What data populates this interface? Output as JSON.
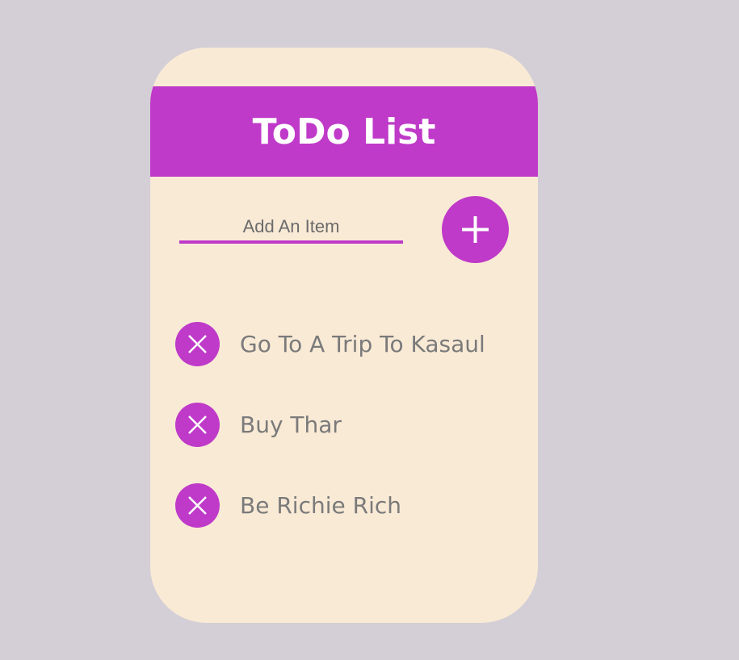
{
  "header": {
    "title": "ToDo List"
  },
  "input": {
    "placeholder": "Add An Item",
    "value": ""
  },
  "add_button": {
    "icon": "plus-icon"
  },
  "items": [
    {
      "text": "Go To A Trip To Kasaul"
    },
    {
      "text": "Buy Thar"
    },
    {
      "text": "Be Richie Rich"
    }
  ],
  "colors": {
    "background": "#d4cfd6",
    "card": "#f9ead6",
    "accent": "#bf3ac8",
    "text": "#7a7a7a"
  }
}
